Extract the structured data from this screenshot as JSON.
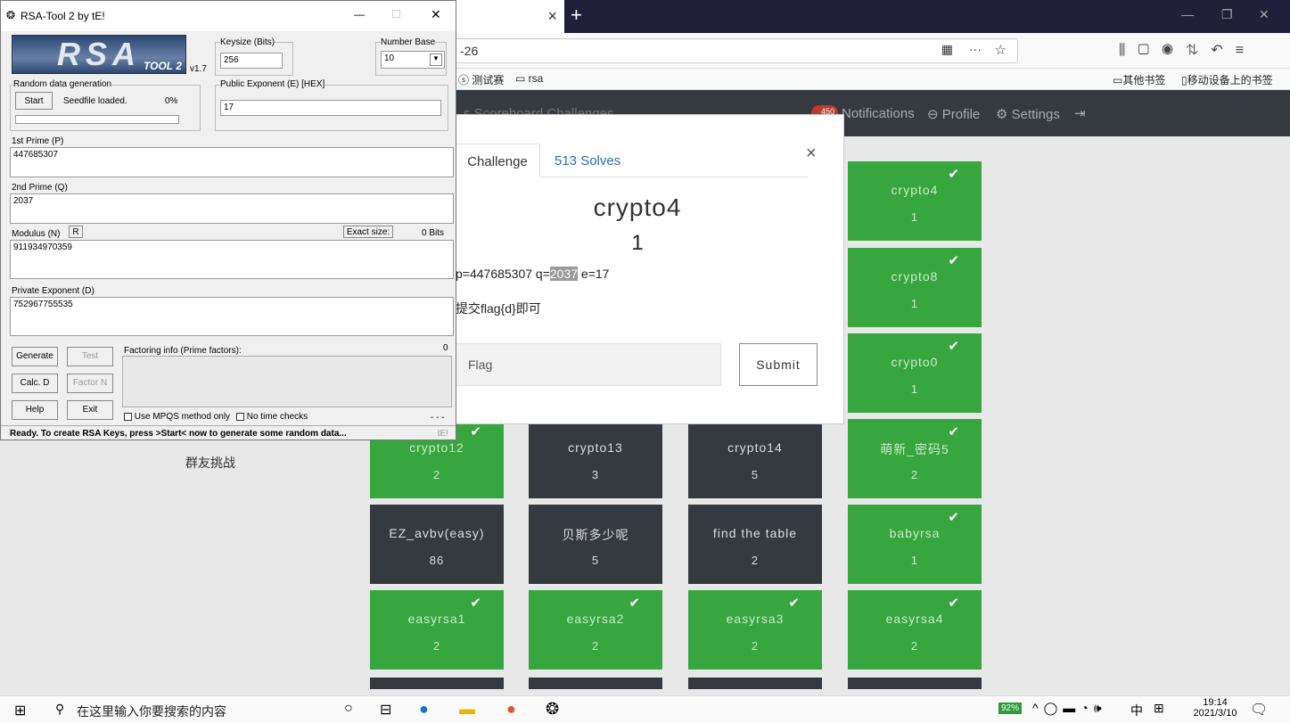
{
  "browser": {
    "tab_title": "",
    "url_suffix": "-26",
    "bookmarks": [
      "测试赛",
      "rsa"
    ],
    "right_bookmarks": [
      "其他书签",
      "移动设备上的书签"
    ]
  },
  "site": {
    "nav_left": "s  Scoreboard  Challenges",
    "notif_count": "450",
    "nav_right": [
      "Notifications",
      "Profile",
      "Settings"
    ],
    "group_label": "群友挑战"
  },
  "modal": {
    "tab_challenge": "Challenge",
    "tab_solves": "513 Solves",
    "title": "crypto4",
    "points": "1",
    "desc_pre": "p=447685307 q=",
    "desc_highlight": "2037",
    "desc_post": " e=17",
    "hint": "提交flag{d}即可",
    "flag_placeholder": "Flag",
    "submit": "Submit",
    "close": "×"
  },
  "cards": [
    {
      "name": "crypto4",
      "val": "1",
      "color": "g",
      "check": true
    },
    {
      "name": "crypto8",
      "val": "1",
      "color": "g",
      "check": true
    },
    {
      "name": "crypto0",
      "val": "1",
      "color": "g",
      "check": true
    },
    {
      "name": "crypto12",
      "val": "2",
      "color": "g",
      "check": true
    },
    {
      "name": "crypto13",
      "val": "3",
      "color": "d",
      "check": false
    },
    {
      "name": "crypto14",
      "val": "5",
      "color": "d",
      "check": false
    },
    {
      "name": "萌新_密码5",
      "val": "2",
      "color": "g",
      "check": true
    },
    {
      "name": "EZ_avbv(easy)",
      "val": "86",
      "color": "d",
      "check": false
    },
    {
      "name": "贝斯多少呢",
      "val": "5",
      "color": "d",
      "check": false
    },
    {
      "name": "find the table",
      "val": "2",
      "color": "d",
      "check": false
    },
    {
      "name": "babyrsa",
      "val": "1",
      "color": "g",
      "check": true
    },
    {
      "name": "easyrsa1",
      "val": "2",
      "color": "g",
      "check": true
    },
    {
      "name": "easyrsa2",
      "val": "2",
      "color": "g",
      "check": true
    },
    {
      "name": "easyrsa3",
      "val": "2",
      "color": "g",
      "check": true
    },
    {
      "name": "easyrsa4",
      "val": "2",
      "color": "g",
      "check": true
    }
  ],
  "rsa": {
    "title": "RSA-Tool 2 by tE!",
    "logo": "RSA",
    "logo_sub": "TOOL 2",
    "version": "v1.7",
    "keysize_label": "Keysize (Bits)",
    "keysize": "256",
    "base_label": "Number Base",
    "base": "10",
    "random_label": "Random data generation",
    "start": "Start",
    "seed": "Seedfile loaded.",
    "pct": "0%",
    "pubexp_label": "Public Exponent (E) [HEX]",
    "pubexp": "17",
    "p_label": "1st Prime (P)",
    "p": "447685307",
    "q_label": "2nd Prime (Q)",
    "q": "2037",
    "n_label": "Modulus (N)",
    "r_btn": "R",
    "exact_btn": "Exact size:",
    "bits": "0  Bits",
    "n": "911934970359",
    "d_label": "Private Exponent (D)",
    "d": "752967755535",
    "generate": "Generate",
    "test": "Test",
    "calcd": "Calc. D",
    "factorn": "Factor N",
    "help": "Help",
    "exit": "Exit",
    "factor_label": "Factoring info (Prime factors):",
    "factor_count": "0",
    "mpqs": "Use MPQS method only",
    "notime": "No time checks",
    "dots": "- - -",
    "status": "Ready. To create RSA Keys, press >Start< now to generate some random data...",
    "status_tag": "tE!"
  },
  "taskbar": {
    "search": "在这里输入你要搜索的内容",
    "battery": "92%",
    "ime": "中",
    "time": "19:14",
    "date": "2021/3/10"
  }
}
